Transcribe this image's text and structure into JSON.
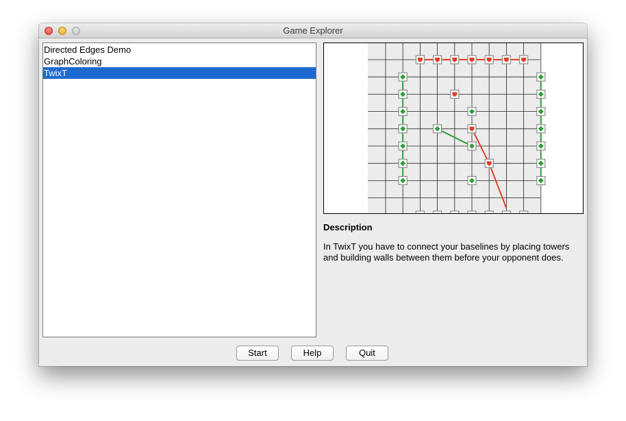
{
  "window": {
    "title": "Game Explorer"
  },
  "games": {
    "items": [
      {
        "label": "Directed Edges Demo",
        "selected": false
      },
      {
        "label": "GraphColoring",
        "selected": false
      },
      {
        "label": "TwixT",
        "selected": true
      }
    ]
  },
  "preview": {
    "board_background": "#ececec",
    "grid_color": "#222222",
    "green_color": "#2f9e3a",
    "red_color": "#e0402a",
    "peg_frame_color": "#8c8c8c"
  },
  "description": {
    "heading": "Description",
    "text": "In TwixT you have to connect your baselines by placing towers and building walls between them before your opponent does."
  },
  "buttons": {
    "start": "Start",
    "help": "Help",
    "quit": "Quit"
  }
}
